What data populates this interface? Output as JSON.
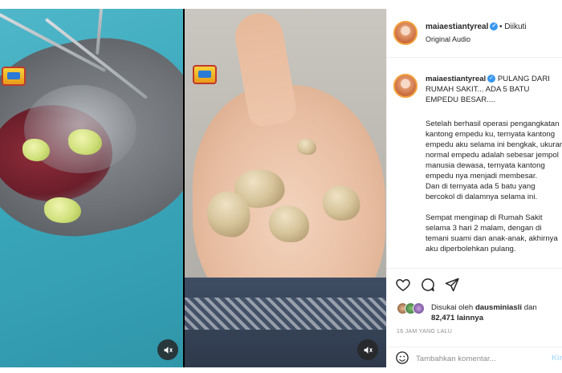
{
  "post": {
    "username": "maiaestiantyreal",
    "follow_separator": "•",
    "follow_label": "Diikuti",
    "audio_label": "Original Audio"
  },
  "caption": {
    "title": "PULANG DARI RUMAH SAKIT... ADA 5 BATU EMPEDU BESAR....",
    "paragraph1": "Setelah berhasil operasi pengangkatan kantong empedu ku, ternyata kantong empedu aku selama ini bengkak, ukuran normal empedu adalah sebesar jempol manusia dewasa, ternyata kantong empedu nya menjadi membesar.\nDan di ternyata ada 5 batu yang bercokol di dalamnya selama ini.",
    "paragraph2": "Sempat menginap di Rumah Sakit selama 3 hari 2 malam, dengan di temani suami dan anak-anak, akhirnya aku diperbolehkan pulang."
  },
  "engagement": {
    "liked_prefix": "Disukai oleh",
    "liked_by": "dausminiasli",
    "liked_and": "dan",
    "others_count": "82,471",
    "others_suffix": "lainnya",
    "time_ago": "16 JAM YANG LALU"
  },
  "comment": {
    "placeholder": "Tambahkan komentar...",
    "post_label": "Kirim"
  },
  "icons": {
    "like": "heart-icon",
    "comment": "comment-icon",
    "share": "send-icon",
    "emoji": "emoji-icon",
    "sound": "speaker-icon"
  },
  "colors": {
    "verified": "#3897f0",
    "text": "#262626",
    "muted": "#8e8e8e",
    "post_button_disabled": "#b2dffc"
  }
}
